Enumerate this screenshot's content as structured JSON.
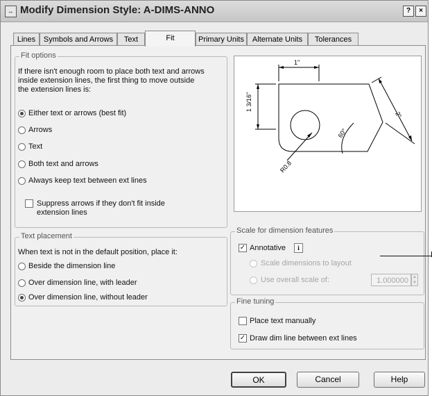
{
  "window": {
    "title": "Modify Dimension Style: A-DIMS-ANNO",
    "help_glyph": "?",
    "close_glyph": "×",
    "app_icon": "dimension-style-icon"
  },
  "tabs": [
    {
      "label": "Lines"
    },
    {
      "label": "Symbols and Arrows"
    },
    {
      "label": "Text"
    },
    {
      "label": "Fit",
      "active": true
    },
    {
      "label": "Primary Units"
    },
    {
      "label": "Alternate Units"
    },
    {
      "label": "Tolerances"
    }
  ],
  "fit_options": {
    "legend": "Fit options",
    "description": "If there isn't enough room to place both text and arrows inside extension lines, the first thing to move outside the extension lines is:",
    "radios": [
      {
        "label": "Either text or arrows (best fit)",
        "checked": true
      },
      {
        "label": "Arrows",
        "checked": false
      },
      {
        "label": "Text",
        "checked": false
      },
      {
        "label": "Both text and arrows",
        "checked": false
      },
      {
        "label": "Always keep text between ext lines",
        "checked": false
      }
    ],
    "suppress_checkbox": {
      "label": "Suppress arrows if they don't fit inside extension lines",
      "checked": false
    }
  },
  "text_placement": {
    "legend": "Text placement",
    "description": "When text is not in the default position, place it:",
    "radios": [
      {
        "label": "Beside the dimension line",
        "checked": false
      },
      {
        "label": "Over dimension line, with leader",
        "checked": false
      },
      {
        "label": "Over dimension line, without leader",
        "checked": true
      }
    ]
  },
  "preview": {
    "dim_top": "1\"",
    "dim_left": "1 3/16\"",
    "dim_right": "2\"",
    "dim_angle": "60°",
    "dim_radius": "R0.8"
  },
  "scale": {
    "legend": "Scale for dimension features",
    "annotative": {
      "label": "Annotative",
      "checked": true,
      "info_glyph": "i"
    },
    "scale_to_layout": {
      "label": "Scale dimensions to layout",
      "enabled": false
    },
    "overall_scale": {
      "label": "Use overall scale of:",
      "enabled": false,
      "value": "1.000000"
    }
  },
  "fine_tuning": {
    "legend": "Fine tuning",
    "place_text_manually": {
      "label": "Place text manually",
      "checked": false
    },
    "draw_dim_line": {
      "label": "Draw dim line between ext lines",
      "checked": true
    }
  },
  "buttons": {
    "ok": "OK",
    "cancel": "Cancel",
    "help": "Help"
  },
  "colors": {
    "window_bg": "#ececec",
    "panel_bg": "#f0f0f0",
    "disabled_text": "#a6a6a6"
  }
}
